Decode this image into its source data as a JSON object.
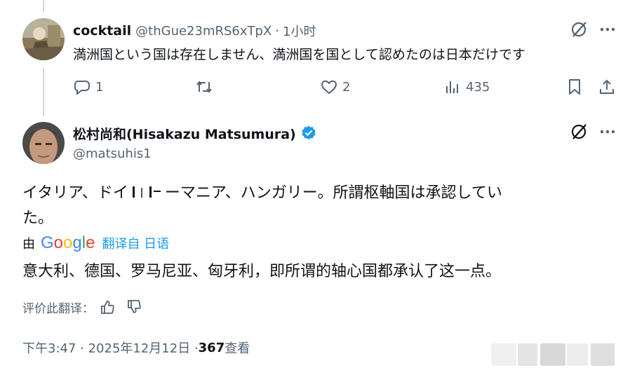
{
  "reply": {
    "name": "cocktail",
    "handle": "@thGue23mRS6xTpX",
    "separator": "·",
    "time": "1小时",
    "text": "満洲国という国は存在しません、満洲国を国として認めたのは日本だけです",
    "actions": {
      "replies": "1",
      "retweets": "",
      "likes": "2",
      "views": "435"
    }
  },
  "main": {
    "name": "松村尚和(Hisakazu Matsumura)",
    "handle": "@matsuhis1",
    "text_line1": "イタリア、ドイ",
    "text_line1_rest": "ーマニア、ハンガリー。所謂枢軸国は承認してい",
    "text_line2": "た。",
    "translation": {
      "by": "由",
      "google_letters": [
        "G",
        "o",
        "o",
        "g",
        "l",
        "e"
      ],
      "google_colors": [
        "#4285F4",
        "#EA4335",
        "#FBBC05",
        "#4285F4",
        "#34A853",
        "#EA4335"
      ],
      "from_label": "翻译自 日语",
      "text": "意大利、德国、罗马尼亚、匈牙利，即所谓的轴心国都承认了这一点。"
    },
    "rate_label": "评价此翻译：",
    "timestamp": "下午3:47 · 2025年12月12日 · ",
    "views_count": "367",
    "views_label": " 查看"
  },
  "colors": {
    "verified": "#1d9bf0",
    "accent_blue": "#1d9bf0",
    "muted": "#536471"
  },
  "icons": [
    "grok-icon",
    "more-icon",
    "reply-icon",
    "retweet-icon",
    "like-icon",
    "views-icon",
    "bookmark-icon",
    "share-icon",
    "verified-badge-icon",
    "thumbs-up-icon",
    "thumbs-down-icon"
  ]
}
